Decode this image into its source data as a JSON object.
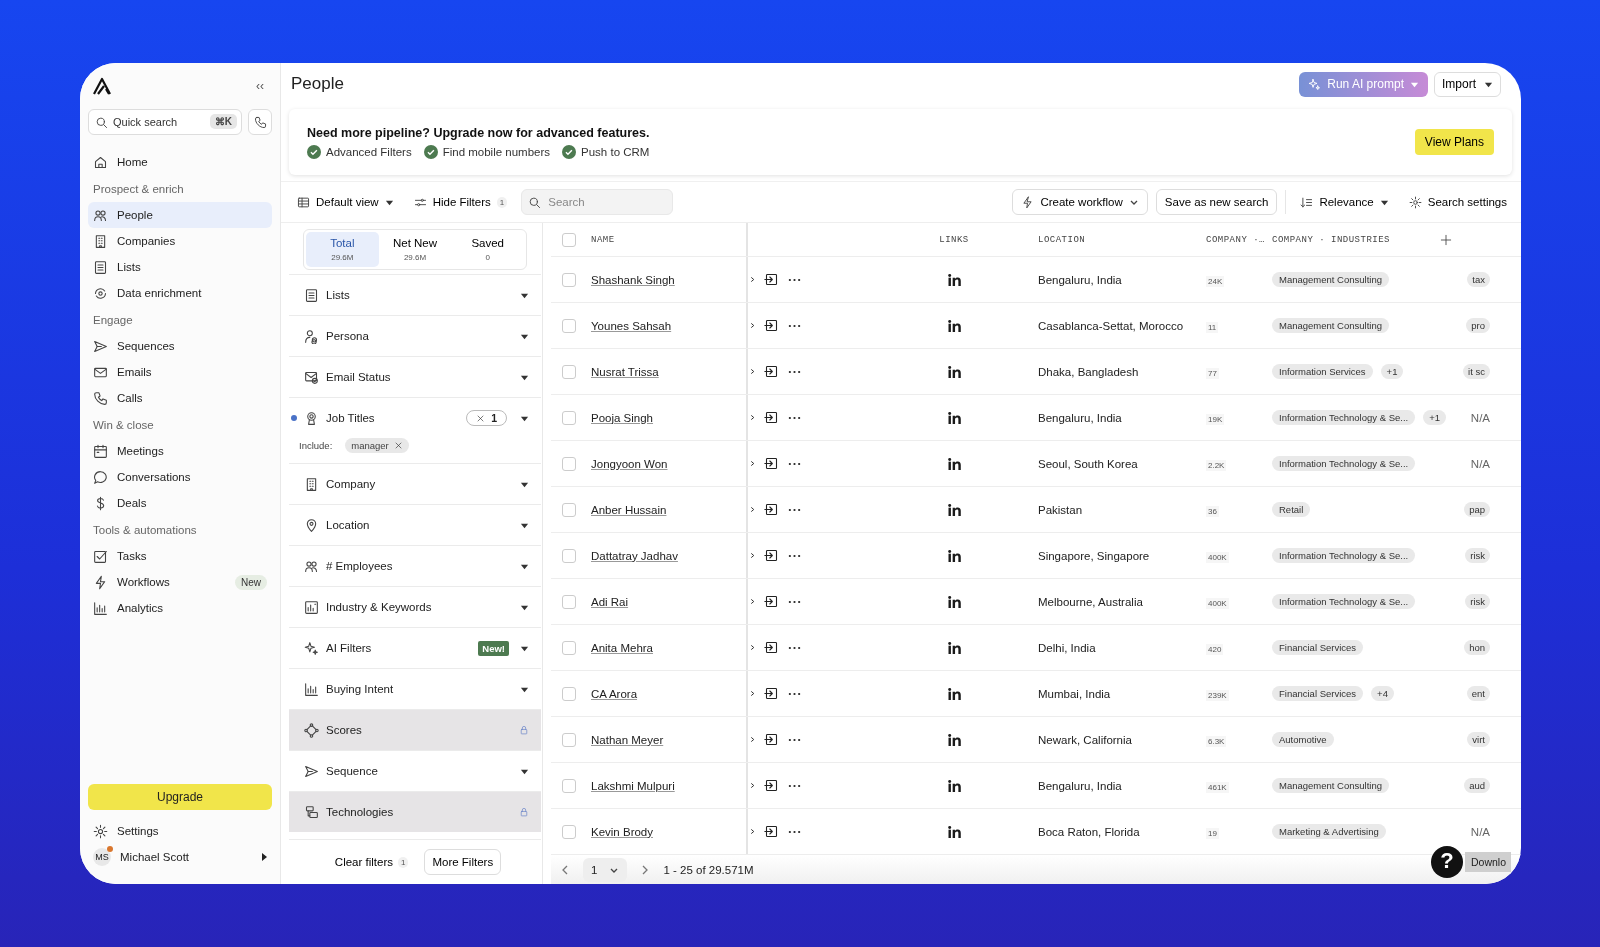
{
  "sidebar": {
    "collapse": "‹‹",
    "quick_search": {
      "placeholder": "Quick search",
      "shortcut": "⌘K"
    },
    "sections": [
      {
        "items": [
          {
            "label": "Home",
            "selected": false
          }
        ]
      },
      {
        "heading": "Prospect & enrich",
        "items": [
          {
            "label": "People",
            "selected": true
          },
          {
            "label": "Companies",
            "selected": false
          },
          {
            "label": "Lists",
            "selected": false
          },
          {
            "label": "Data enrichment",
            "selected": false
          }
        ]
      },
      {
        "heading": "Engage",
        "items": [
          {
            "label": "Sequences",
            "selected": false
          },
          {
            "label": "Emails",
            "selected": false
          },
          {
            "label": "Calls",
            "selected": false
          }
        ]
      },
      {
        "heading": "Win & close",
        "items": [
          {
            "label": "Meetings",
            "selected": false
          },
          {
            "label": "Conversations",
            "selected": false
          },
          {
            "label": "Deals",
            "selected": false
          }
        ]
      },
      {
        "heading": "Tools & automations",
        "items": [
          {
            "label": "Tasks",
            "selected": false
          },
          {
            "label": "Workflows",
            "selected": false,
            "badge": "New"
          },
          {
            "label": "Analytics",
            "selected": false
          }
        ]
      }
    ],
    "upgrade": "Upgrade",
    "settings": "Settings",
    "user": {
      "initials": "MS",
      "name": "Michael Scott",
      "notification": true
    }
  },
  "header": {
    "title": "People",
    "ai_button": "Run AI prompt",
    "import_button": "Import"
  },
  "banner": {
    "headline": "Need more pipeline? Upgrade now for advanced features.",
    "features": [
      "Advanced Filters",
      "Find mobile numbers",
      "Push to CRM"
    ],
    "button": "View Plans"
  },
  "toolbar": {
    "view": "Default view",
    "hide_filters": "Hide Filters",
    "filter_count": "1",
    "search": {
      "placeholder": "Search"
    },
    "create_workflow": "Create workflow",
    "save_search": "Save as new search",
    "sort": "Relevance",
    "settings": "Search settings"
  },
  "filters": {
    "tabs": [
      {
        "label": "Total",
        "count": "29.6M",
        "selected": true
      },
      {
        "label": "Net New",
        "count": "29.6M",
        "selected": false
      },
      {
        "label": "Saved",
        "count": "0",
        "selected": false
      }
    ],
    "items": [
      {
        "label": "Lists",
        "kind": "dropdown"
      },
      {
        "label": "Persona",
        "kind": "dropdown"
      },
      {
        "label": "Email Status",
        "kind": "dropdown"
      },
      {
        "label": "Job Titles",
        "kind": "dropdown",
        "active": true,
        "count": "1",
        "include_label": "Include:",
        "values": [
          "manager"
        ]
      },
      {
        "label": "Company",
        "kind": "dropdown"
      },
      {
        "label": "Location",
        "kind": "dropdown"
      },
      {
        "label": "# Employees",
        "kind": "dropdown"
      },
      {
        "label": "Industry & Keywords",
        "kind": "dropdown"
      },
      {
        "label": "AI Filters",
        "kind": "dropdown",
        "badge": "New!"
      },
      {
        "label": "Buying Intent",
        "kind": "dropdown"
      },
      {
        "label": "Scores",
        "kind": "locked"
      },
      {
        "label": "Sequence",
        "kind": "dropdown"
      },
      {
        "label": "Technologies",
        "kind": "locked"
      }
    ],
    "clear": "Clear filters",
    "clear_count": "1",
    "more": "More Filters"
  },
  "table": {
    "columns": [
      "NAME",
      "LINKS",
      "LOCATION",
      "COMPANY ·…",
      "COMPANY · INDUSTRIES"
    ],
    "all_checked": false,
    "rows": [
      {
        "name": "Shashank Singh",
        "checked": false,
        "location": "Bengaluru, India",
        "size": "24K",
        "industries": [
          "Management Consulting"
        ],
        "column_last": {
          "text": "tax",
          "kind": "tag"
        }
      },
      {
        "name": "Younes Sahsah",
        "checked": false,
        "location": "Casablanca-Settat, Morocco",
        "size": "11",
        "industries": [
          "Management Consulting"
        ],
        "column_last": {
          "text": "pro",
          "kind": "tag"
        }
      },
      {
        "name": "Nusrat Trissa",
        "checked": false,
        "location": "Dhaka, Bangladesh",
        "size": "77",
        "industries": [
          "Information Services"
        ],
        "more": "+1",
        "column_last": {
          "text": "it sc",
          "kind": "tag"
        }
      },
      {
        "name": "Pooja Singh",
        "checked": false,
        "location": "Bengaluru, India",
        "size": "19K",
        "industries": [
          "Information Technology & Se..."
        ],
        "more": "+1",
        "column_last": {
          "text": "N/A",
          "kind": "text"
        }
      },
      {
        "name": "Jongyoon Won",
        "checked": false,
        "location": "Seoul, South Korea",
        "size": "2.2K",
        "industries": [
          "Information Technology & Se..."
        ],
        "column_last": {
          "text": "N/A",
          "kind": "text"
        }
      },
      {
        "name": "Anber Hussain",
        "checked": false,
        "location": "Pakistan",
        "size": "36",
        "industries": [
          "Retail"
        ],
        "column_last": {
          "text": "pap",
          "kind": "tag"
        }
      },
      {
        "name": "Dattatray Jadhav",
        "checked": false,
        "location": "Singapore, Singapore",
        "size": "400K",
        "industries": [
          "Information Technology & Se..."
        ],
        "column_last": {
          "text": "risk",
          "kind": "tag"
        }
      },
      {
        "name": "Adi Rai",
        "checked": false,
        "location": "Melbourne, Australia",
        "size": "400K",
        "industries": [
          "Information Technology & Se..."
        ],
        "column_last": {
          "text": "risk",
          "kind": "tag"
        }
      },
      {
        "name": "Anita Mehra",
        "checked": false,
        "location": "Delhi, India",
        "size": "420",
        "industries": [
          "Financial Services"
        ],
        "column_last": {
          "text": "hon",
          "kind": "tag"
        }
      },
      {
        "name": "CA Arora",
        "checked": false,
        "location": "Mumbai, India",
        "size": "239K",
        "industries": [
          "Financial Services"
        ],
        "more": "+4",
        "column_last": {
          "text": "ent",
          "kind": "tag"
        }
      },
      {
        "name": "Nathan Meyer",
        "checked": false,
        "location": "Newark, California",
        "size": "6.3K",
        "industries": [
          "Automotive"
        ],
        "column_last": {
          "text": "virt",
          "kind": "tag"
        }
      },
      {
        "name": "Lakshmi Mulpuri",
        "checked": false,
        "location": "Bengaluru, India",
        "size": "461K",
        "industries": [
          "Management Consulting"
        ],
        "column_last": {
          "text": "aud",
          "kind": "tag"
        }
      },
      {
        "name": "Kevin Brody",
        "checked": false,
        "location": "Boca Raton, Florida",
        "size": "19",
        "industries": [
          "Marketing & Advertising"
        ],
        "column_last": {
          "text": "N/A",
          "kind": "text"
        }
      }
    ]
  },
  "pagination": {
    "page": "1",
    "summary": "1 - 25 of 29.571M"
  },
  "help": {
    "label": "?",
    "tooltip": "Downlo"
  }
}
